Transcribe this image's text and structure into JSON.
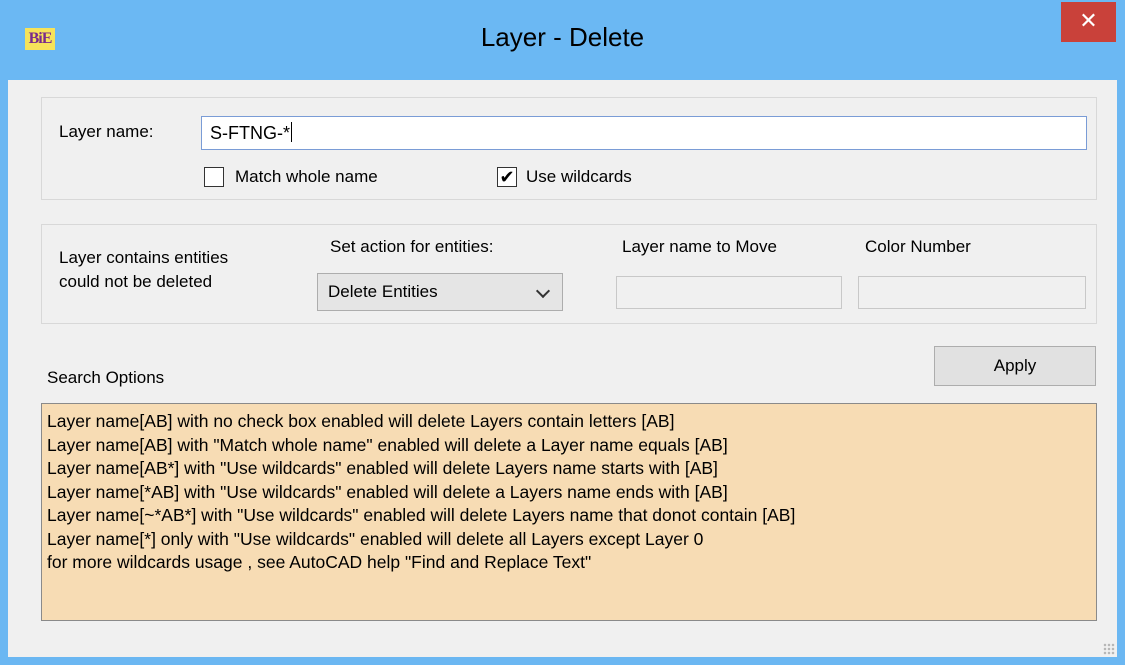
{
  "window": {
    "title": "Layer - Delete",
    "logo_text": "BiE",
    "close_glyph": "✕"
  },
  "layer_name": {
    "label": "Layer name:",
    "value": "S-FTNG-*",
    "match_whole_name": {
      "label": "Match whole name",
      "checked": false
    },
    "use_wildcards": {
      "label": "Use wildcards",
      "checked": true,
      "check_glyph": "✔"
    }
  },
  "entities": {
    "info_line1": "Layer contains  entities",
    "info_line2": "could not be deleted",
    "action_label": "Set action for entities:",
    "action_selected": "Delete Entities",
    "move_label": "Layer name to Move",
    "color_label": "Color Number"
  },
  "search": {
    "label": "Search Options",
    "apply_label": "Apply",
    "help_lines": [
      "Layer name[AB] with no check box enabled will delete  Layers contain letters [AB]",
      "Layer name[AB] with \"Match whole name\" enabled will delete a Layer name equals [AB]",
      "Layer name[AB*] with \"Use wildcards\" enabled will delete  Layers name starts with [AB]",
      "Layer name[*AB] with \"Use wildcards\" enabled will delete a Layers name ends with [AB]",
      "Layer name[~*AB*] with \"Use wildcards\" enabled will delete Layers name that donot contain [AB]",
      "Layer name[*] only with \"Use wildcards\" enabled will delete all Layers except Layer 0",
      "for more wildcards usage , see AutoCAD help  \"Find and Replace Text\""
    ]
  },
  "colors": {
    "titlebar": "#6bb8f3",
    "close": "#c9413a",
    "help_background": "#f7dcb4"
  }
}
